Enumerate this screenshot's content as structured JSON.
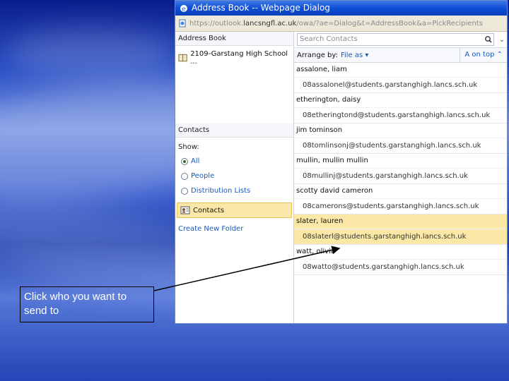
{
  "window": {
    "title": "Address Book -- Webpage Dialog"
  },
  "url": {
    "prefix": "https://outlook.",
    "host": "lancsngfl.ac.uk",
    "path": "/owa/?ae=Dialog&t=AddressBook&a=PickRecipients"
  },
  "left_pane": {
    "address_book_header": "Address Book",
    "address_book_item": "2109-Garstang High School ...",
    "contacts_header": "Contacts",
    "show_label": "Show:",
    "filters": [
      {
        "label": "All",
        "selected": true
      },
      {
        "label": "People",
        "selected": false
      },
      {
        "label": "Distribution Lists",
        "selected": false
      }
    ],
    "contacts_folder": "Contacts",
    "create_new_folder": "Create New Folder"
  },
  "right_pane": {
    "search_placeholder": "Search Contacts",
    "arrange_label": "Arrange by:",
    "arrange_value": "File as",
    "sort_label": "A on top",
    "contacts": [
      {
        "name": "assalone, liam",
        "email": "08assalonel@students.garstanghigh.lancs.sch.uk"
      },
      {
        "name": "etherington, daisy",
        "email": "08etheringtond@students.garstanghigh.lancs.sch.uk"
      },
      {
        "name": "jim tominson",
        "email": "08tomlinsonj@students.garstanghigh.lancs.sch.uk"
      },
      {
        "name": "mullin, mullin mullin",
        "email": "08mullinj@students.garstanghigh.lancs.sch.uk"
      },
      {
        "name": "scotty david cameron",
        "email": "08camerons@students.garstanghigh.lancs.sch.uk"
      },
      {
        "name": "slater, lauren",
        "email": "08slaterl@students.garstanghigh.lancs.sch.uk",
        "selected": true
      },
      {
        "name": "watt, olivia",
        "email": "08watto@students.garstanghigh.lancs.sch.uk"
      }
    ]
  },
  "callout": {
    "text": "Click who you want to send to"
  }
}
